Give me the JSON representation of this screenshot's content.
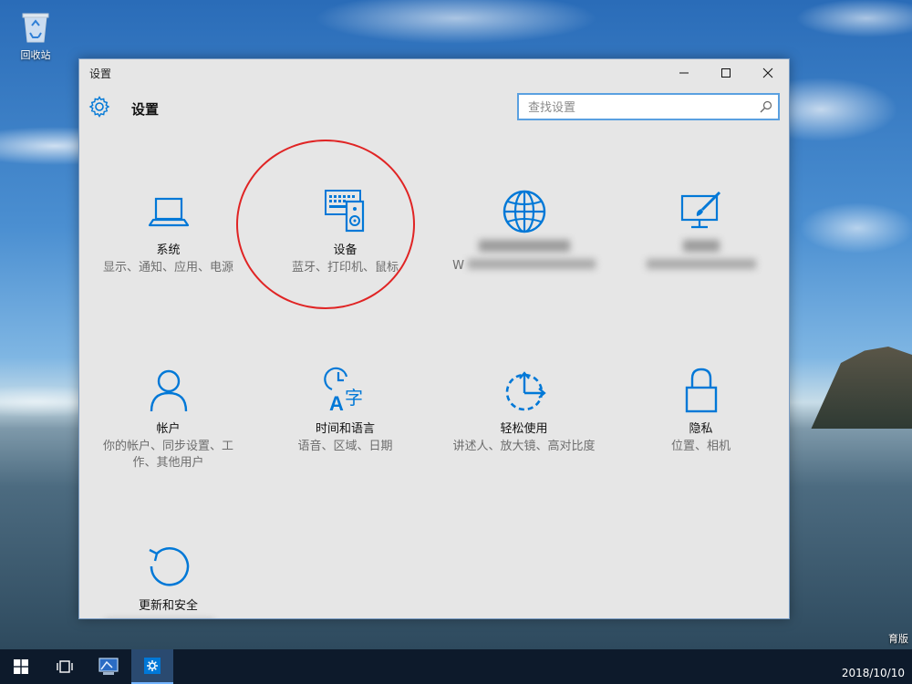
{
  "desktop": {
    "recycle_bin_label": "回收站",
    "corner_fragment": "育版"
  },
  "window": {
    "title": "设置",
    "header_title": "设置",
    "search_placeholder": "查找设置"
  },
  "tiles": [
    {
      "title": "系统",
      "desc": "显示、通知、应用、电源",
      "icon": "laptop-icon"
    },
    {
      "title": "设备",
      "desc": "蓝牙、打印机、鼠标",
      "icon": "keyboard-speaker-icon"
    },
    {
      "title": "",
      "desc": "W",
      "icon": "globe-icon"
    },
    {
      "title": "",
      "desc": "",
      "icon": "paint-display-icon"
    },
    {
      "title": "帐户",
      "desc": "你的帐户、同步设置、工作、其他用户",
      "icon": "person-icon"
    },
    {
      "title": "时间和语言",
      "desc": "语音、区域、日期",
      "icon": "clock-language-icon"
    },
    {
      "title": "轻松使用",
      "desc": "讲述人、放大镜、高对比度",
      "icon": "ease-of-access-icon"
    },
    {
      "title": "隐私",
      "desc": "位置、相机",
      "icon": "lock-icon"
    },
    {
      "title": "更新和安全",
      "desc": "",
      "icon": "refresh-icon"
    }
  ],
  "taskbar": {
    "date": "2018/10/10"
  },
  "colors": {
    "accent": "#0078d7",
    "highlight_circle": "#e02424",
    "taskbar": "#0d1a2b"
  }
}
